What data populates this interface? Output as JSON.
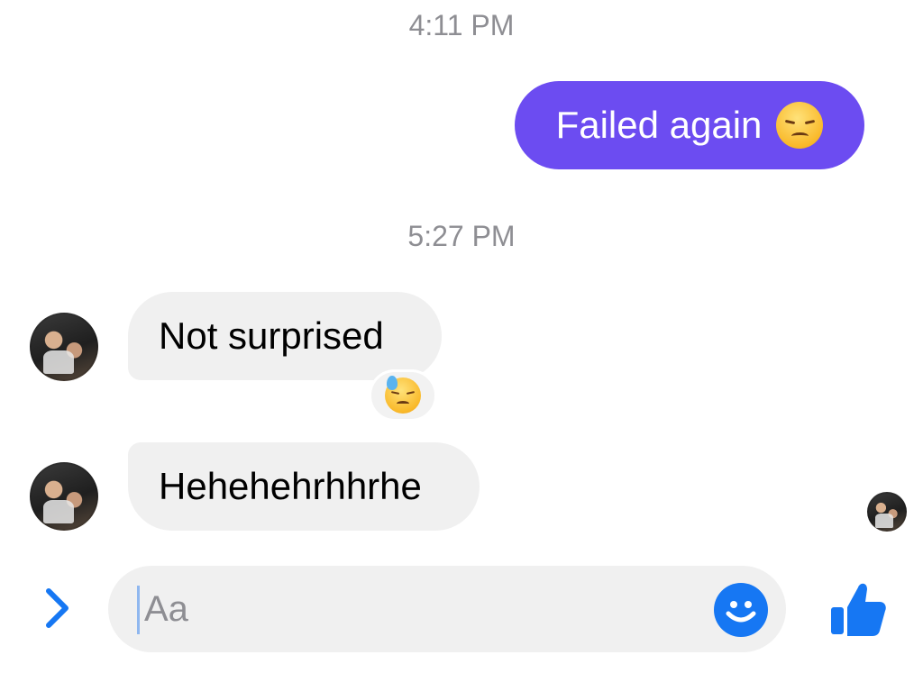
{
  "conversation": {
    "timestamps": [
      "4:11 PM",
      "5:27 PM"
    ],
    "messages": [
      {
        "direction": "outgoing",
        "text": "Failed again",
        "emoji": "disappointed-face-emoji"
      },
      {
        "direction": "incoming",
        "text": "Not surprised",
        "reaction": "downcast-face-with-sweat-emoji"
      },
      {
        "direction": "incoming",
        "text": "Hehehehrhhrhe"
      }
    ]
  },
  "composer": {
    "placeholder": "Aa",
    "value": "",
    "icons": {
      "expand": "chevron-right-icon",
      "emoji": "smiley-icon",
      "like": "thumbs-up-icon"
    }
  },
  "colors": {
    "outgoing_bubble": "#6c4cf1",
    "incoming_bubble": "#f0f0f0",
    "accent": "#1677f3",
    "timestamp": "#8e8e93"
  }
}
